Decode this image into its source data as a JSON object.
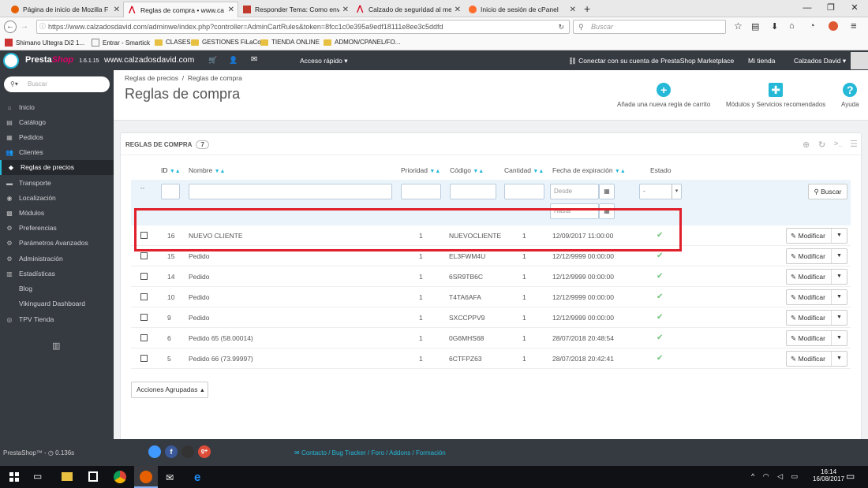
{
  "browser": {
    "tabs": [
      {
        "title": "Página de inicio de Mozilla F",
        "fav_color": "#e66000"
      },
      {
        "title": "Reglas de compra • www.ca",
        "fav_color": "#d6001c"
      },
      {
        "title": "Responder Tema: Como env",
        "fav_color": "#c0392b"
      },
      {
        "title": "Calzado de seguridad al mej",
        "fav_color": "#d6001c"
      },
      {
        "title": "Inicio de sesión de cPanel",
        "fav_color": "#ff6c2c"
      }
    ],
    "url": "https://www.calzadosdavid.com/adminwe/index.php?controller=AdminCartRules&token=8fcc1c0e395a9edf18111e8ee3c5ddfd",
    "search_placeholder": "Buscar",
    "bookmarks": [
      "Shimano Ultegra Di2 1...",
      "Entrar - Smartick",
      "CLASES",
      "GESTIONES FiLaCo",
      "TIENDA ONLINE",
      "ADMON/CPANEL/FO..."
    ]
  },
  "header": {
    "brand_a": "Presta",
    "brand_b": "Shop",
    "version": "1.6.1.15",
    "site": "www.calzadosdavid.com",
    "quick_access": "Acceso rápido",
    "marketplace": "Conectar con su cuenta de PrestaShop Marketplace",
    "my_store": "Mi tienda",
    "user": "Calzados David"
  },
  "sidebar": {
    "search_placeholder": "Buscar",
    "items": [
      {
        "label": "Inicio",
        "icon": "⌂"
      },
      {
        "label": "Catálogo",
        "icon": "▤"
      },
      {
        "label": "Pedidos",
        "icon": "▦"
      },
      {
        "label": "Clientes",
        "icon": "👥"
      },
      {
        "label": "Reglas de precios",
        "icon": "◆"
      },
      {
        "label": "Transporte",
        "icon": "▬"
      },
      {
        "label": "Localización",
        "icon": "◉"
      },
      {
        "label": "Módulos",
        "icon": "▩"
      },
      {
        "label": "Preferencias",
        "icon": "⚙"
      },
      {
        "label": "Parámetros Avanzados",
        "icon": "⚙"
      },
      {
        "label": "Administración",
        "icon": "⚙"
      },
      {
        "label": "Estadísticas",
        "icon": "▥"
      },
      {
        "label": "Blog",
        "icon": ""
      },
      {
        "label": "Vikinguard Dashboard",
        "icon": ""
      },
      {
        "label": "TPV Tienda",
        "icon": "◎"
      }
    ]
  },
  "page": {
    "breadcrumb_parent": "Reglas de precios",
    "breadcrumb_sep": "/",
    "breadcrumb_current": "Reglas de compra",
    "title": "Reglas de compra",
    "toolbar": {
      "add": "Añada una nueva regla de carrito",
      "modules": "Módulos y Servicios recomendados",
      "help": "Ayuda"
    }
  },
  "panel": {
    "title": "REGLAS DE COMPRA",
    "count": "7",
    "columns": [
      "ID",
      "Nombre",
      "Prioridad",
      "Código",
      "Cantidad",
      "Fecha de expiración",
      "Estado"
    ],
    "filter": {
      "from_placeholder": "Desde",
      "to_placeholder": "Hasta",
      "status_value": "-",
      "search_label": "Buscar",
      "dash": "--"
    },
    "rows": [
      {
        "id": "16",
        "name": "NUEVO CLIENTE",
        "priority": "1",
        "code": "NUEVOCLIENTE",
        "quantity": "1",
        "expiry": "12/09/2017 11:00:00",
        "status": "✔"
      },
      {
        "id": "15",
        "name": "Pedido",
        "priority": "1",
        "code": "EL3FWM4U",
        "quantity": "1",
        "expiry": "12/12/9999 00:00:00",
        "status": "✔"
      },
      {
        "id": "14",
        "name": "Pedido",
        "priority": "1",
        "code": "6SR9TB6C",
        "quantity": "1",
        "expiry": "12/12/9999 00:00:00",
        "status": "✔"
      },
      {
        "id": "10",
        "name": "Pedido",
        "priority": "1",
        "code": "T4TA6AFA",
        "quantity": "1",
        "expiry": "12/12/9999 00:00:00",
        "status": "✔"
      },
      {
        "id": "9",
        "name": "Pedido",
        "priority": "1",
        "code": "SXCCPPV9",
        "quantity": "1",
        "expiry": "12/12/9999 00:00:00",
        "status": "✔"
      },
      {
        "id": "6",
        "name": "Pedido 65 (58.00014)",
        "priority": "1",
        "code": "0G6MHS68",
        "quantity": "1",
        "expiry": "28/07/2018 20:48:54",
        "status": "✔"
      },
      {
        "id": "5",
        "name": "Pedido 66 (73.99997)",
        "priority": "1",
        "code": "6CTFPZ63",
        "quantity": "1",
        "expiry": "28/07/2018 20:42:41",
        "status": "✔"
      }
    ],
    "row_action": "Modificar",
    "bulk_actions": "Acciones Agrupadas"
  },
  "footer": {
    "version": "PrestaShop™ - ",
    "time": "0.136s",
    "links": [
      "Contacto",
      "Bug Tracker",
      "Foro",
      "Addons",
      "Formación"
    ]
  },
  "taskbar": {
    "time": "16:14",
    "date": "16/08/2017"
  }
}
